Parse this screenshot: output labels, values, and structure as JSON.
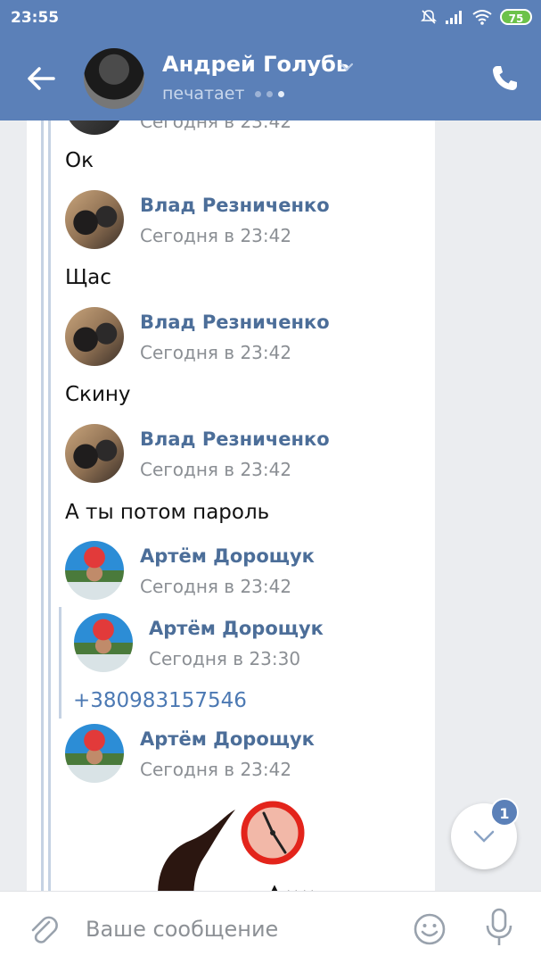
{
  "status_bar": {
    "time": "23:55",
    "battery": "75"
  },
  "header": {
    "contact_name": "Андрей Голубь",
    "status": "печатает"
  },
  "messages": {
    "top_partial_time": "Сегодня в 23:42",
    "items": [
      {
        "text": "Ок"
      },
      {
        "sender": "Влад Резниченко",
        "time": "Сегодня в 23:42",
        "text": "Щас"
      },
      {
        "sender": "Влад Резниченко",
        "time": "Сегодня в 23:42",
        "text": "Скину"
      },
      {
        "sender": "Влад Резниченко",
        "time": "Сегодня в 23:42",
        "text": "А ты потом пароль"
      },
      {
        "sender": "Артём Дорощук",
        "time": "Сегодня в 23:42"
      },
      {
        "sender": "Артём Дорощук",
        "time": "Сегодня в 23:30",
        "text": "+380983157546"
      },
      {
        "sender": "Артём Дорощук",
        "time": "Сегодня в 23:42"
      }
    ]
  },
  "scroll_down": {
    "badge": "1"
  },
  "composer": {
    "placeholder": "Ваше сообщение"
  },
  "colors": {
    "header_bg": "#5b80b8",
    "link": "#4c79b3",
    "sender_name": "#4c6e99"
  }
}
